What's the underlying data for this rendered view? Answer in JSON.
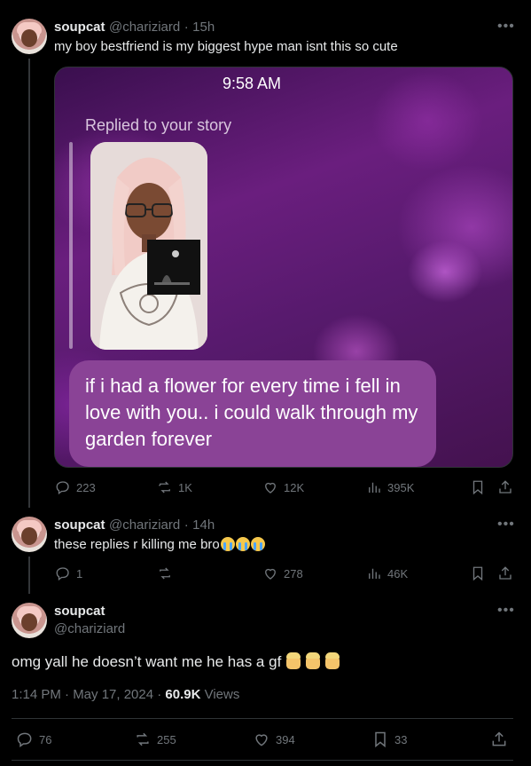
{
  "tweet1": {
    "name": "soupcat",
    "handle": "@chariziard",
    "sep": "·",
    "time": "15h",
    "text": "my boy bestfriend is my biggest hype man isnt this so cute",
    "media": {
      "clock": "9:58 AM",
      "replied": "Replied to your story",
      "message": "if i had a flower for every time i fell in love with you.. i could walk through my garden forever"
    },
    "stats": {
      "replies": "223",
      "reposts": "1K",
      "likes": "12K",
      "views": "395K"
    }
  },
  "tweet2": {
    "name": "soupcat",
    "handle": "@chariziard",
    "sep": "·",
    "time": "14h",
    "text": "these replies r killing me bro",
    "stats": {
      "replies": "1",
      "likes": "278",
      "views": "46K"
    }
  },
  "tweet3": {
    "name": "soupcat",
    "handle": "@chariziard",
    "text": "omg yall he doesn’t want me he has a gf",
    "meta_time": "1:14 PM · May 17, 2024 · ",
    "views_count": "60.9K",
    "views_label": " Views",
    "stats": {
      "replies": "76",
      "reposts": "255",
      "likes": "394",
      "bookmarks": "33"
    }
  },
  "icons": [
    "more-icon",
    "reply-icon",
    "repost-icon",
    "like-icon",
    "views-icon",
    "bookmark-icon",
    "share-icon",
    "loudly-crying-face-icon",
    "woman-facepalming-icon"
  ],
  "colors": {
    "background": "#000000",
    "text": "#e7e9ea",
    "muted": "#71767b",
    "media_purple": "#6a1e7e",
    "bubble": "#8a4396"
  }
}
